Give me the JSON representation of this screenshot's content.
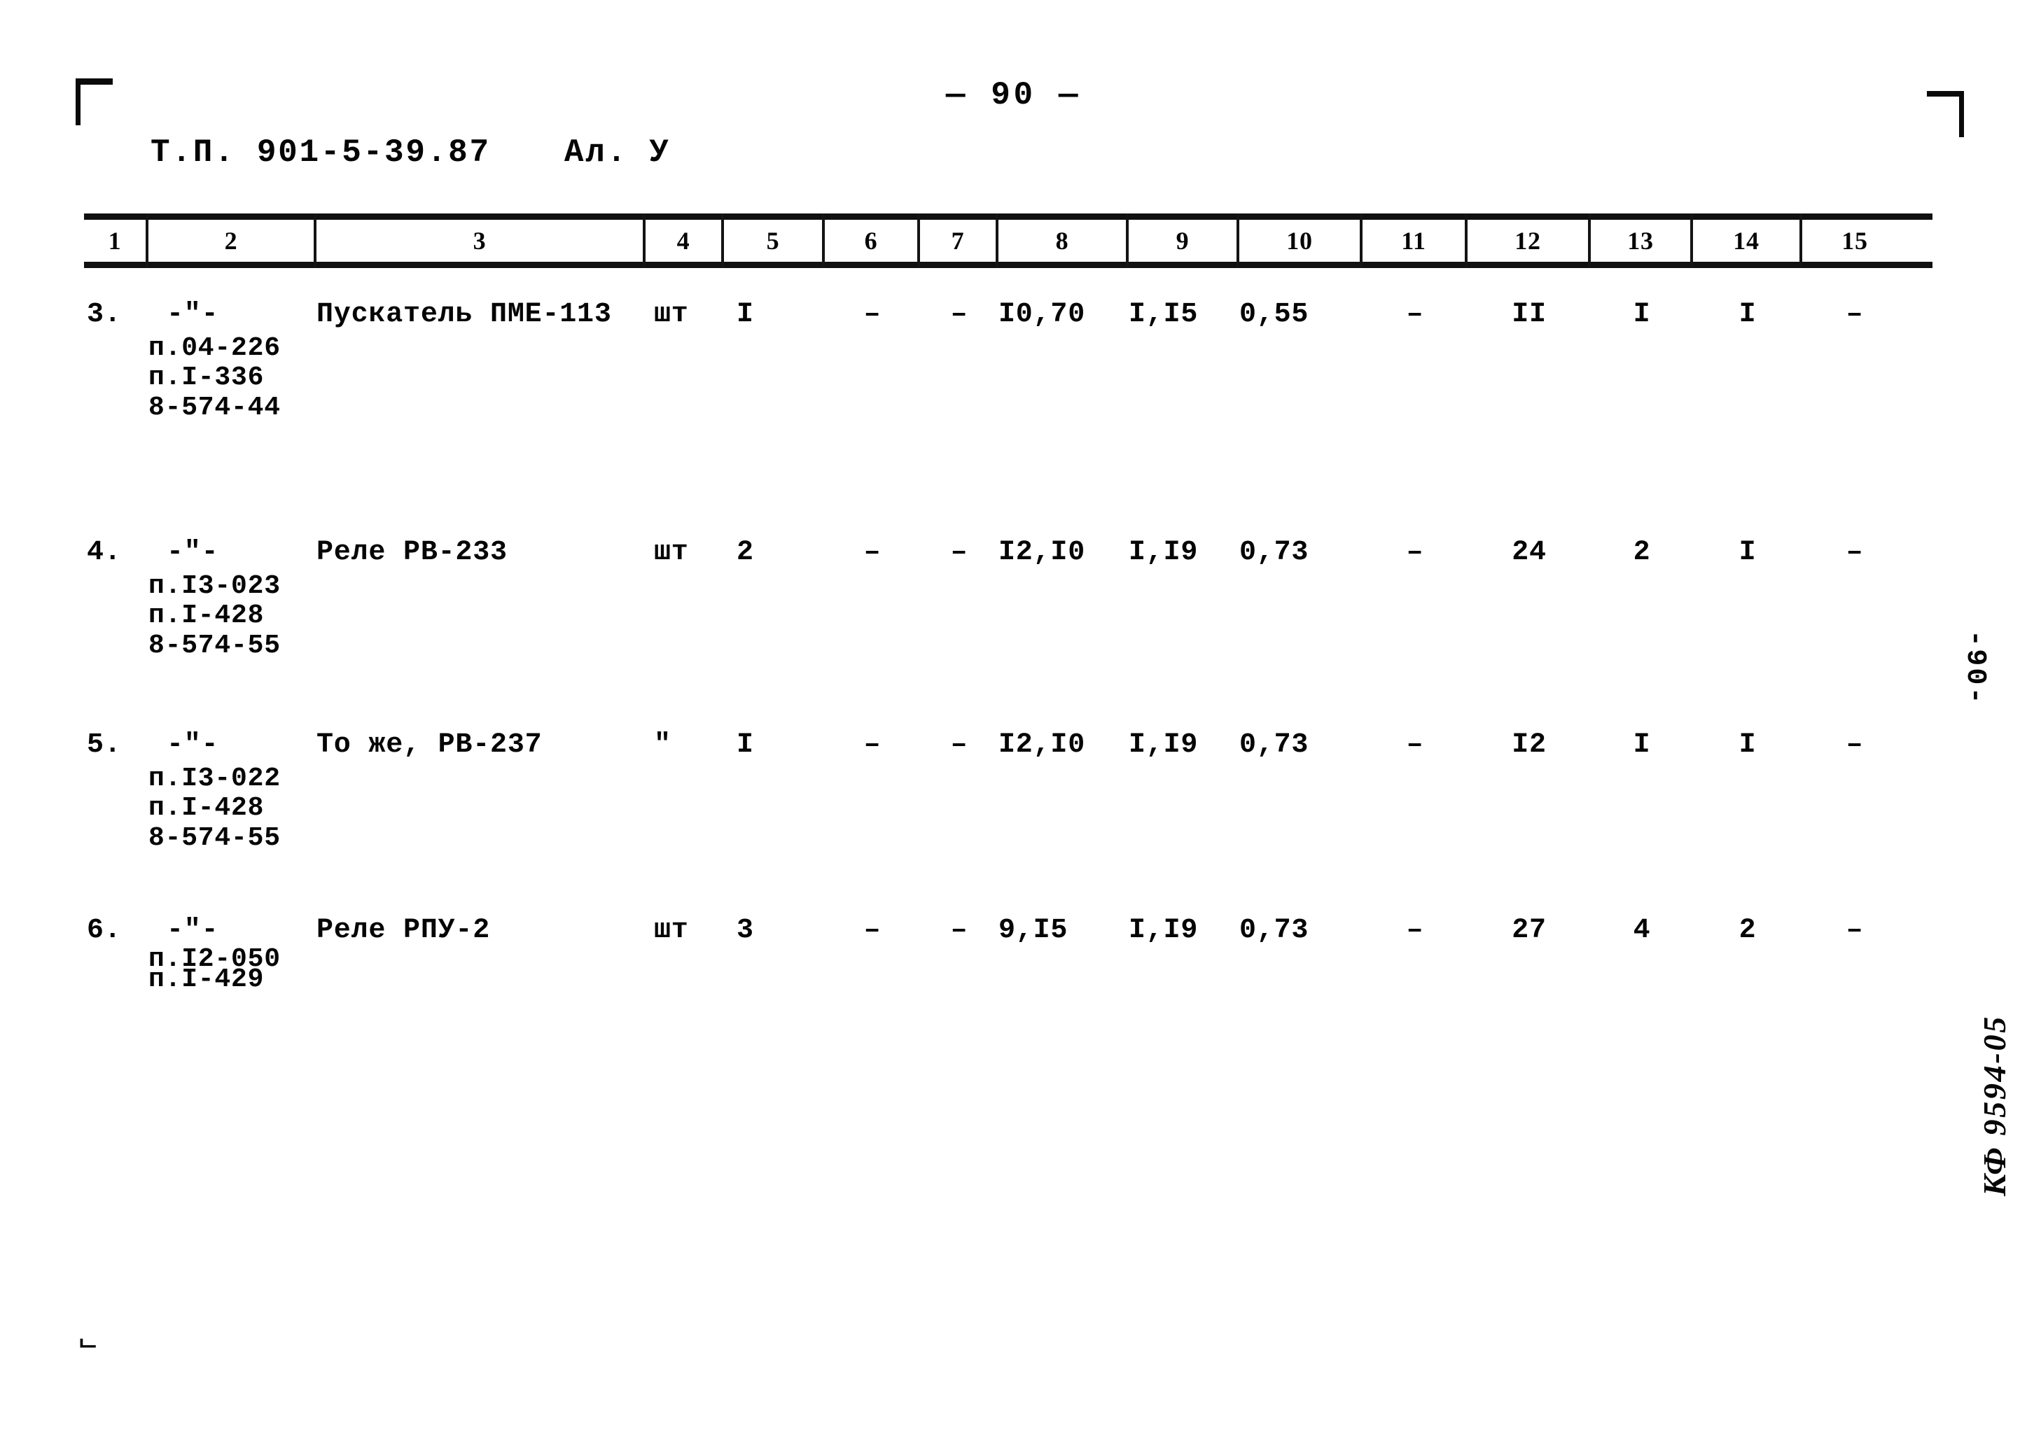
{
  "page": {
    "page_number_top": "— 90 —",
    "side_page_number": "-90-",
    "archive_mark": "КФ 9594-05",
    "bottom_mark": "ᄂ"
  },
  "header": {
    "doc_code": "Т.П. 901-5-39.87",
    "album": "Ал. У"
  },
  "table": {
    "column_headers": [
      "1",
      "2",
      "3",
      "4",
      "5",
      "6",
      "7",
      "8",
      "9",
      "10",
      "11",
      "12",
      "13",
      "14",
      "15"
    ],
    "rows": [
      {
        "num": "3.",
        "ref_mark": "-\"-",
        "refs": [
          "п.04-226",
          "п.I-336",
          "8-574-44"
        ],
        "name": "Пускатель ПМЕ-113",
        "unit": "шт",
        "qty": "I",
        "c6": "–",
        "c7": "–",
        "c8": "I0,70",
        "c9": "I,I5",
        "c10": "0,55",
        "c11": "–",
        "c12": "II",
        "c13": "I",
        "c14": "I",
        "c15": "–"
      },
      {
        "num": "4.",
        "ref_mark": "-\"-",
        "refs": [
          "п.I3-023",
          "п.I-428",
          "8-574-55"
        ],
        "name": "Реле РВ-233",
        "unit": "шт",
        "qty": "2",
        "c6": "–",
        "c7": "–",
        "c8": "I2,I0",
        "c9": "I,I9",
        "c10": "0,73",
        "c11": "–",
        "c12": "24",
        "c13": "2",
        "c14": "I",
        "c15": "–"
      },
      {
        "num": "5.",
        "ref_mark": "-\"-",
        "refs": [
          "п.I3-022",
          "п.I-428",
          "8-574-55"
        ],
        "name": "То же, РВ-237",
        "unit": "\"",
        "qty": "I",
        "c6": "–",
        "c7": "–",
        "c8": "I2,I0",
        "c9": "I,I9",
        "c10": "0,73",
        "c11": "–",
        "c12": "I2",
        "c13": "I",
        "c14": "I",
        "c15": "–"
      },
      {
        "num": "6.",
        "ref_mark": "-\"-",
        "refs": [
          "п.I2-050",
          "п.I-429"
        ],
        "name": "Реле РПУ-2",
        "unit": "шт",
        "qty": "3",
        "c6": "–",
        "c7": "–",
        "c8": "9,I5",
        "c9": "I,I9",
        "c10": "0,73",
        "c11": "–",
        "c12": "27",
        "c13": "4",
        "c14": "2",
        "c15": "–"
      }
    ]
  }
}
